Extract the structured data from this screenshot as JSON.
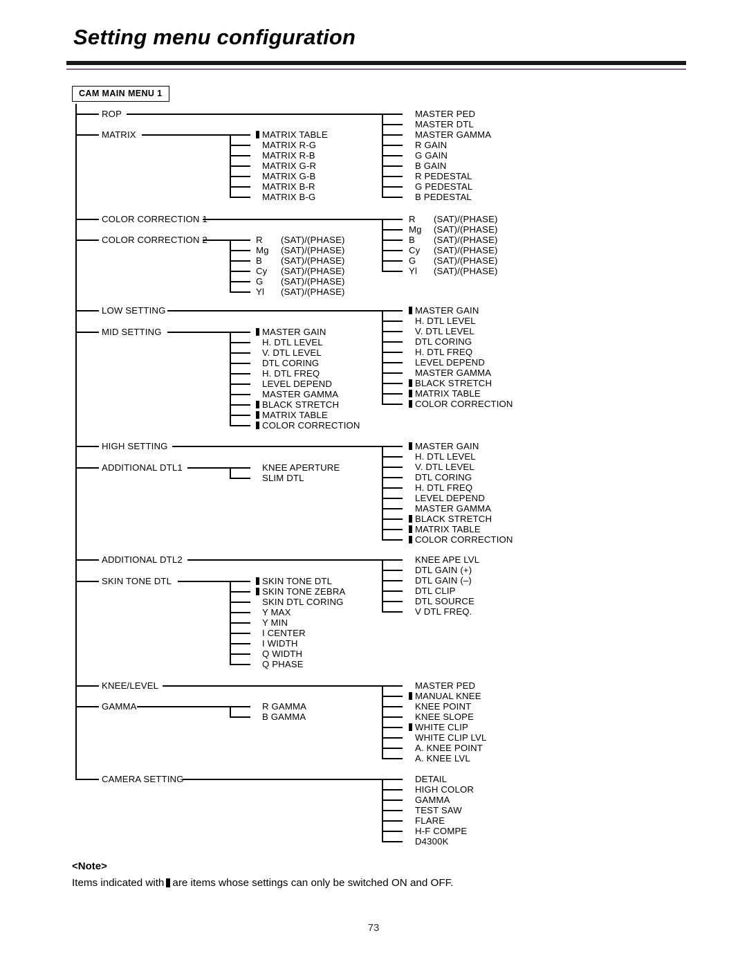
{
  "page": {
    "title": "Setting menu configuration",
    "number": "73"
  },
  "root": {
    "label": "CAM MAIN MENU 1"
  },
  "note": {
    "heading": "<Note>",
    "text_before": "Items indicated with",
    "text_after": "are items whose settings can only be switched ON and OFF."
  },
  "tree": {
    "branches": [
      {
        "label": "ROP",
        "children": [
          {
            "label": "MASTER PED",
            "marker": false
          },
          {
            "label": "MASTER DTL",
            "marker": false
          },
          {
            "label": "MASTER GAMMA",
            "marker": false
          },
          {
            "label": "R GAIN",
            "marker": false
          },
          {
            "label": "G GAIN",
            "marker": false
          },
          {
            "label": "B GAIN",
            "marker": false
          },
          {
            "label": "R PEDESTAL",
            "marker": false
          },
          {
            "label": "G PEDESTAL",
            "marker": false
          },
          {
            "label": "B PEDESTAL",
            "marker": false
          }
        ]
      },
      {
        "label": "MATRIX",
        "children": [
          {
            "label": "MATRIX TABLE",
            "marker": true
          },
          {
            "label": "MATRIX R-G",
            "marker": false
          },
          {
            "label": "MATRIX R-B",
            "marker": false
          },
          {
            "label": "MATRIX G-R",
            "marker": false
          },
          {
            "label": "MATRIX G-B",
            "marker": false
          },
          {
            "label": "MATRIX B-R",
            "marker": false
          },
          {
            "label": "MATRIX B-G",
            "marker": false
          }
        ]
      },
      {
        "label": "COLOR CORRECTION 1",
        "children": [
          {
            "color": "R",
            "param": "(SAT)/(PHASE)"
          },
          {
            "color": "Mg",
            "param": "(SAT)/(PHASE)"
          },
          {
            "color": "B",
            "param": "(SAT)/(PHASE)"
          },
          {
            "color": "Cy",
            "param": "(SAT)/(PHASE)"
          },
          {
            "color": "G",
            "param": "(SAT)/(PHASE)"
          },
          {
            "color": "Yl",
            "param": "(SAT)/(PHASE)"
          }
        ]
      },
      {
        "label": "COLOR CORRECTION 2",
        "children": [
          {
            "color": "R",
            "param": "(SAT)/(PHASE)"
          },
          {
            "color": "Mg",
            "param": "(SAT)/(PHASE)"
          },
          {
            "color": "B",
            "param": "(SAT)/(PHASE)"
          },
          {
            "color": "Cy",
            "param": "(SAT)/(PHASE)"
          },
          {
            "color": "G",
            "param": "(SAT)/(PHASE)"
          },
          {
            "color": "Yl",
            "param": "(SAT)/(PHASE)"
          }
        ]
      },
      {
        "label": "LOW SETTING",
        "children": [
          {
            "label": "MASTER GAIN",
            "marker": true
          },
          {
            "label": "H. DTL LEVEL",
            "marker": false
          },
          {
            "label": "V. DTL LEVEL",
            "marker": false
          },
          {
            "label": "DTL CORING",
            "marker": false
          },
          {
            "label": "H. DTL FREQ",
            "marker": false
          },
          {
            "label": "LEVEL DEPEND",
            "marker": false
          },
          {
            "label": "MASTER GAMMA",
            "marker": false
          },
          {
            "label": "BLACK STRETCH",
            "marker": true
          },
          {
            "label": "MATRIX TABLE",
            "marker": true
          },
          {
            "label": "COLOR CORRECTION",
            "marker": true
          }
        ]
      },
      {
        "label": "MID SETTING",
        "children": [
          {
            "label": "MASTER GAIN",
            "marker": true
          },
          {
            "label": "H. DTL LEVEL",
            "marker": false
          },
          {
            "label": "V. DTL LEVEL",
            "marker": false
          },
          {
            "label": "DTL CORING",
            "marker": false
          },
          {
            "label": "H. DTL FREQ",
            "marker": false
          },
          {
            "label": "LEVEL DEPEND",
            "marker": false
          },
          {
            "label": "MASTER GAMMA",
            "marker": false
          },
          {
            "label": "BLACK STRETCH",
            "marker": true
          },
          {
            "label": "MATRIX TABLE",
            "marker": true
          },
          {
            "label": "COLOR CORRECTION",
            "marker": true
          }
        ]
      },
      {
        "label": "HIGH SETTING",
        "children": [
          {
            "label": "MASTER GAIN",
            "marker": true
          },
          {
            "label": "H. DTL LEVEL",
            "marker": false
          },
          {
            "label": "V. DTL LEVEL",
            "marker": false
          },
          {
            "label": "DTL CORING",
            "marker": false
          },
          {
            "label": "H. DTL FREQ",
            "marker": false
          },
          {
            "label": "LEVEL DEPEND",
            "marker": false
          },
          {
            "label": "MASTER GAMMA",
            "marker": false
          },
          {
            "label": "BLACK STRETCH",
            "marker": true
          },
          {
            "label": "MATRIX TABLE",
            "marker": true
          },
          {
            "label": "COLOR CORRECTION",
            "marker": true
          }
        ]
      },
      {
        "label": "ADDITIONAL DTL1",
        "children": [
          {
            "label": "KNEE APERTURE",
            "marker": false
          },
          {
            "label": "SLIM DTL",
            "marker": false
          }
        ]
      },
      {
        "label": "ADDITIONAL DTL2",
        "children": [
          {
            "label": "KNEE APE LVL",
            "marker": false
          },
          {
            "label": "DTL GAIN (+)",
            "marker": false
          },
          {
            "label": "DTL GAIN (–)",
            "marker": false
          },
          {
            "label": "DTL CLIP",
            "marker": false
          },
          {
            "label": "DTL SOURCE",
            "marker": false
          },
          {
            "label": "V DTL FREQ.",
            "marker": false
          }
        ]
      },
      {
        "label": "SKIN TONE DTL",
        "children": [
          {
            "label": "SKIN TONE DTL",
            "marker": true
          },
          {
            "label": "SKIN TONE ZEBRA",
            "marker": true
          },
          {
            "label": "SKIN DTL CORING",
            "marker": false
          },
          {
            "label": "Y MAX",
            "marker": false
          },
          {
            "label": "Y MIN",
            "marker": false
          },
          {
            "label": "I CENTER",
            "marker": false
          },
          {
            "label": "I WIDTH",
            "marker": false
          },
          {
            "label": "Q WIDTH",
            "marker": false
          },
          {
            "label": "Q PHASE",
            "marker": false
          }
        ]
      },
      {
        "label": "KNEE/LEVEL",
        "children": [
          {
            "label": "MASTER PED",
            "marker": false
          },
          {
            "label": "MANUAL KNEE",
            "marker": true
          },
          {
            "label": "KNEE POINT",
            "marker": false
          },
          {
            "label": "KNEE SLOPE",
            "marker": false
          },
          {
            "label": "WHITE CLIP",
            "marker": true
          },
          {
            "label": "WHITE CLIP LVL",
            "marker": false
          },
          {
            "label": "A. KNEE POINT",
            "marker": false
          },
          {
            "label": "A. KNEE LVL",
            "marker": false
          }
        ]
      },
      {
        "label": "GAMMA",
        "children": [
          {
            "label": "R GAMMA",
            "marker": false
          },
          {
            "label": "B GAMMA",
            "marker": false
          }
        ]
      },
      {
        "label": "CAMERA SETTING",
        "children": [
          {
            "label": "DETAIL",
            "marker": false
          },
          {
            "label": "HIGH COLOR",
            "marker": false
          },
          {
            "label": "GAMMA",
            "marker": false
          },
          {
            "label": "TEST SAW",
            "marker": false
          },
          {
            "label": "FLARE",
            "marker": false
          },
          {
            "label": "H-F COMPE",
            "marker": false
          },
          {
            "label": "D4300K",
            "marker": false
          }
        ]
      }
    ]
  }
}
